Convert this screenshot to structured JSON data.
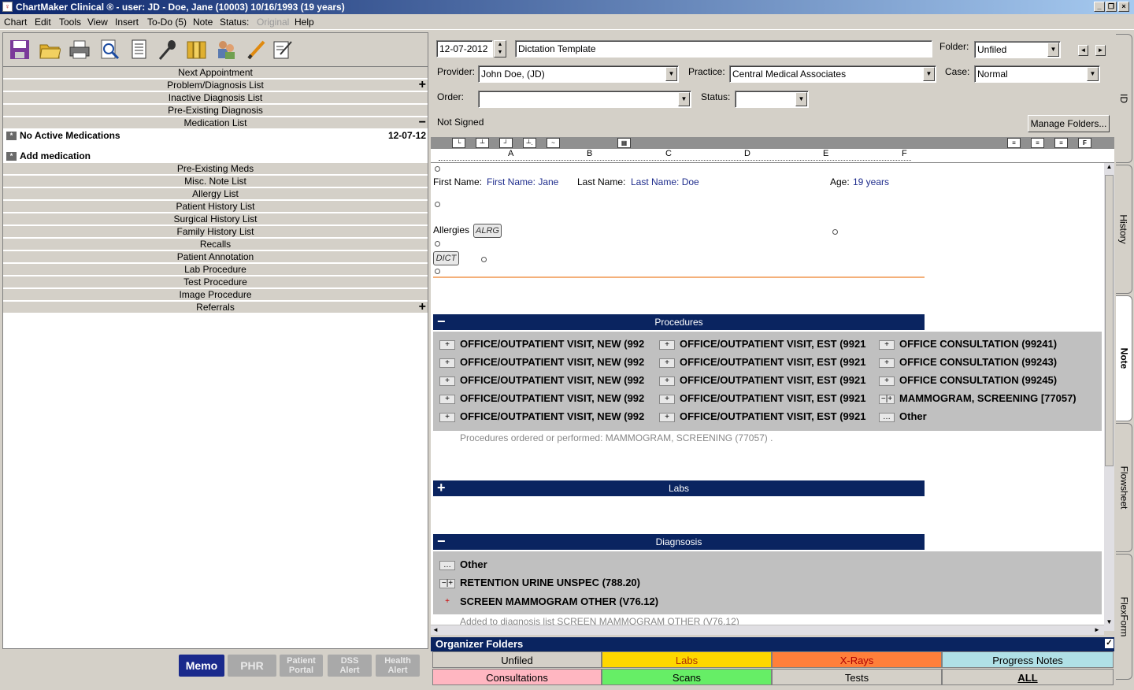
{
  "window": {
    "title": "ChartMaker Clinical ® - user: JD - Doe, Jane (10003) 10/16/1993 (19 years)"
  },
  "menu": [
    "Chart",
    "Edit",
    "Tools",
    "View",
    "Insert",
    "To-Do (5)",
    "Note",
    "Status:",
    "Original",
    "Help"
  ],
  "left": {
    "lists_top": [
      "Next Appointment",
      "Problem/Diagnosis List",
      "Inactive Diagnosis List",
      "Pre-Existing Diagnosis",
      "Medication List"
    ],
    "med_none": "No Active Medications",
    "med_date": "12-07-12",
    "add_med": "Add medication",
    "lists_bottom": [
      "Pre-Existing Meds",
      "Misc. Note List",
      "Allergy List",
      "Patient History List",
      "Surgical History List",
      "Family History List",
      "Recalls",
      "Patient Annotation",
      "Lab Procedure",
      "Test Procedure",
      "Image Procedure",
      "Referrals"
    ],
    "buttons": {
      "memo": "Memo",
      "phr": "PHR",
      "portal": "Patient Portal",
      "dss": "DSS Alert",
      "health": "Health Alert"
    }
  },
  "header": {
    "date": "12-07-2012",
    "template": "Dictation Template",
    "folder_label": "Folder:",
    "folder": "Unfiled",
    "provider_label": "Provider:",
    "provider": "John Doe, (JD)",
    "practice_label": "Practice:",
    "practice": "Central Medical Associates",
    "case_label": "Case:",
    "case": "Normal",
    "order_label": "Order:",
    "status_label": "Status:",
    "signed": "Not Signed",
    "manage": "Manage Folders..."
  },
  "ruler": [
    "A",
    "B",
    "C",
    "D",
    "E",
    "F"
  ],
  "doc": {
    "first_label": "First Name:",
    "first_val": "First Name: Jane",
    "last_label": "Last Name:",
    "last_val": "Last Name: Doe",
    "age_label": "Age:",
    "age_val": "19 years",
    "allergies": "Allergies",
    "alrg": "ALRG",
    "dict": "DICT",
    "procedures_title": "Procedures",
    "procedures": [
      [
        "OFFICE/OUTPATIENT VISIT, NEW (992",
        "OFFICE/OUTPATIENT VISIT, EST (9921",
        "OFFICE CONSULTATION (99241)"
      ],
      [
        "OFFICE/OUTPATIENT VISIT, NEW (992",
        "OFFICE/OUTPATIENT VISIT, EST (9921",
        "OFFICE CONSULTATION (99243)"
      ],
      [
        "OFFICE/OUTPATIENT VISIT, NEW (992",
        "OFFICE/OUTPATIENT VISIT, EST (9921",
        "OFFICE CONSULTATION (99245)"
      ],
      [
        "OFFICE/OUTPATIENT VISIT, NEW (992",
        "OFFICE/OUTPATIENT VISIT, EST (9921",
        "MAMMOGRAM, SCREENING [77057)"
      ],
      [
        "OFFICE/OUTPATIENT VISIT, NEW (992",
        "OFFICE/OUTPATIENT VISIT, EST (9921",
        "Other"
      ]
    ],
    "proc_note": "Procedures ordered or performed: MAMMOGRAM, SCREENING (77057) .",
    "labs_title": "Labs",
    "diag_title": "Diagnsosis",
    "diag_items": [
      "Other",
      "RETENTION URINE UNSPEC (788.20)",
      "SCREEN MAMMOGRAM OTHER (V76.12)"
    ],
    "diag_note": "Added to diagnosis list SCREEN MAMMOGRAM OTHER (V76.12)"
  },
  "organizer": {
    "title": "Organizer Folders",
    "folders": [
      {
        "label": "Unfiled",
        "color": "#d4d0c8"
      },
      {
        "label": "Labs",
        "color": "#ffd700"
      },
      {
        "label": "X-Rays",
        "color": "#ff7f3a"
      },
      {
        "label": "Progress Notes",
        "color": "#b0e0e6"
      },
      {
        "label": "Consultations",
        "color": "#ffb6c1"
      },
      {
        "label": "Scans",
        "color": "#66ee66"
      },
      {
        "label": "Tests",
        "color": "#d4d0c8"
      },
      {
        "label": "ALL",
        "color": "#d4d0c8"
      }
    ]
  },
  "sidetabs": [
    "ID",
    "History",
    "Note",
    "Flowsheet",
    "FlexForm"
  ]
}
